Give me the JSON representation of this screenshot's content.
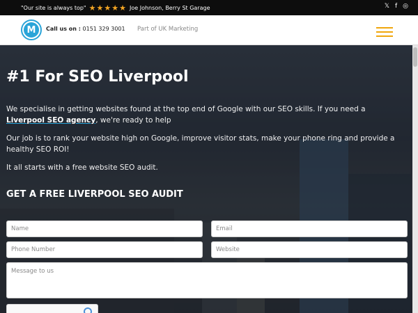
{
  "topbar": {
    "quote": "\"Our site is always top\"",
    "stars": [
      "★",
      "★",
      "★",
      "★",
      "★"
    ],
    "attribution": "Joe Johnson, Berry St Garage",
    "social": [
      {
        "name": "x-icon",
        "glyph": "𝕏"
      },
      {
        "name": "facebook-icon",
        "glyph": "f"
      },
      {
        "name": "instagram-icon",
        "glyph": "◎"
      }
    ]
  },
  "header": {
    "logo_letter": "M",
    "call_label": "Call us on :",
    "phone": "0151 329 3001",
    "partof": "Part of UK Marketing"
  },
  "hero": {
    "title": "#1 For SEO Liverpool",
    "p1_before": "We specialise in getting websites found at the top end of Google with our SEO skills. If you need a ",
    "p1_link": "Liverpool SEO agency",
    "p1_after": ", we're ready to help",
    "p2": "Our job is to rank your website high on Google, improve visitor stats, make your phone ring and provide a healthy SEO ROI!",
    "p3": "It all starts with a free website SEO audit.",
    "form_title": "GET A FREE LIVERPOOL SEO AUDIT"
  },
  "form": {
    "name_placeholder": "Name",
    "email_placeholder": "Email",
    "phone_placeholder": "Phone Number",
    "website_placeholder": "Website",
    "message_placeholder": "Message to us"
  },
  "colors": {
    "accent": "#2aa4d8",
    "burger": "#f0a60c",
    "star": "#f5a623",
    "topbar_bg": "#0d0d0d"
  }
}
